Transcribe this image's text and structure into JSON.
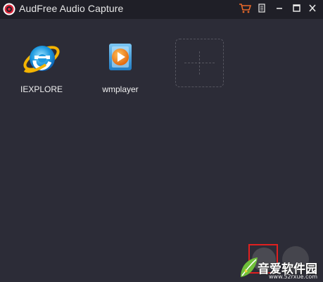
{
  "window": {
    "title": "AudFree Audio Capture"
  },
  "titlebar_buttons": [
    {
      "name": "cart-icon"
    },
    {
      "name": "menu-icon"
    },
    {
      "name": "minimize-icon"
    },
    {
      "name": "maximize-icon"
    },
    {
      "name": "close-icon"
    }
  ],
  "apps": [
    {
      "label": "IEXPLORE",
      "icon": "internet-explorer-icon"
    },
    {
      "label": "wmplayer",
      "icon": "windows-media-player-icon"
    }
  ],
  "add_tile": {
    "icon": "plus-icon"
  },
  "bottom_controls": {
    "record_button": "record-button",
    "secondary_button": "records-list-button"
  },
  "watermark": {
    "text": "音爱软件园",
    "subtext": "www.52rxue.com"
  },
  "colors": {
    "background": "#2c2c37",
    "titlebar": "#1f1f27",
    "accent_cart": "#e8692a",
    "highlight": "#e02020"
  }
}
